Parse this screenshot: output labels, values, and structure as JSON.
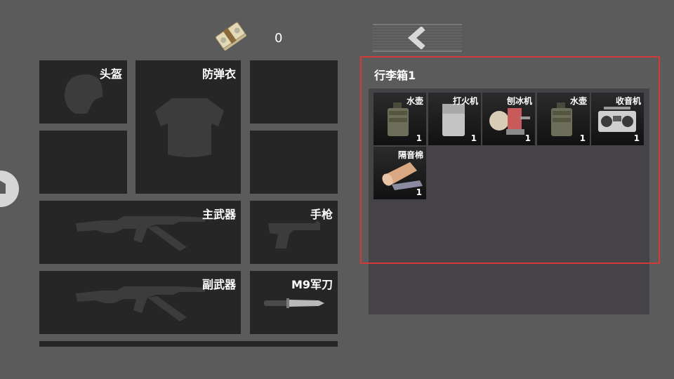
{
  "currency": {
    "icon": "cash-bundle-icon",
    "amount": "0"
  },
  "back_button": {
    "icon": "chevron-left-icon"
  },
  "equipment": {
    "helmet": "头盔",
    "armor": "防弹衣",
    "primary": "主武器",
    "pistol": "手枪",
    "secondary": "副武器",
    "knife": "M9军刀"
  },
  "container": {
    "title": "行李箱1",
    "items": [
      {
        "name": "水壶",
        "qty": "1",
        "icon": "canteen-icon"
      },
      {
        "name": "打火机",
        "qty": "1",
        "icon": "lighter-icon"
      },
      {
        "name": "刨冰机",
        "qty": "1",
        "icon": "ice-shaver-icon"
      },
      {
        "name": "水壶",
        "qty": "1",
        "icon": "canteen-icon"
      },
      {
        "name": "收音机",
        "qty": "1",
        "icon": "radio-icon"
      },
      {
        "name": "隔音棉",
        "qty": "1",
        "icon": "foam-roll-icon"
      }
    ]
  },
  "colors": {
    "background": "#5b5b5b",
    "slot": "#262626",
    "panel": "#464348",
    "highlight": "#d23a3a"
  }
}
